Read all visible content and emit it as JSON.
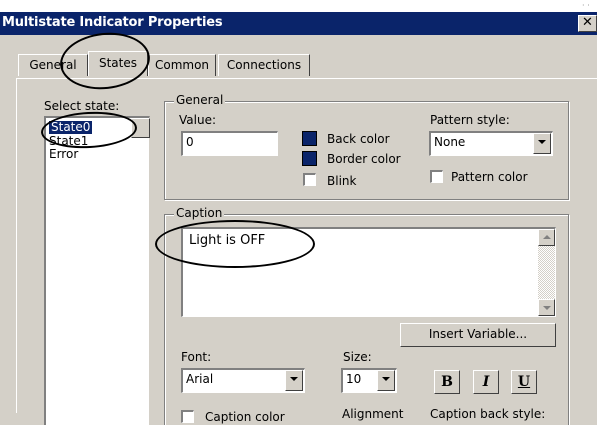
{
  "dialog": {
    "title": "Multistate Indicator Properties",
    "close_glyph": "✕"
  },
  "tabs": [
    {
      "label": "General"
    },
    {
      "label": "States"
    },
    {
      "label": "Common"
    },
    {
      "label": "Connections"
    }
  ],
  "states": {
    "label": "Select state:",
    "items": [
      "State0",
      "State1",
      "Error"
    ],
    "selected": "State0"
  },
  "general_group": {
    "title": "General",
    "value_label": "Value:",
    "value": "0",
    "back_color_label": "Back color",
    "border_color_label": "Border color",
    "blink_label": "Blink",
    "pattern_style_label": "Pattern style:",
    "pattern_style_value": "None",
    "pattern_color_label": "Pattern color",
    "swatch_color": "#0a246a"
  },
  "caption_group": {
    "title": "Caption",
    "text": "Light is OFF",
    "insert_variable_label": "Insert Variable...",
    "font_label": "Font:",
    "font_value": "Arial",
    "size_label": "Size:",
    "size_value": "10",
    "bold_label": "B",
    "italic_label": "I",
    "underline_label": "U",
    "caption_color_label": "Caption color",
    "alignment_label": "Alignment",
    "caption_back_style_label": "Caption back style:"
  },
  "colors": {
    "titlebar": "#0a246a",
    "face": "#d4d0c8",
    "selection": "#0a246a"
  }
}
